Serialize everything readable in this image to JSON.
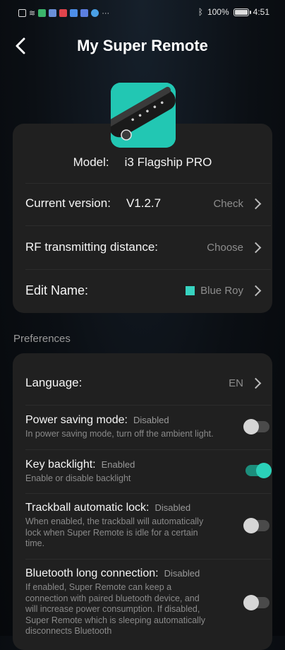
{
  "status_bar": {
    "battery_percent": "100%",
    "time": "4:51"
  },
  "header": {
    "title": "My Super Remote"
  },
  "device": {
    "model_label": "Model:",
    "model_value": "i3 Flagship PRO",
    "version_label": "Current version:",
    "version_value": "V1.2.7",
    "version_action": "Check",
    "rf_label": "RF transmitting distance:",
    "rf_action": "Choose",
    "name_label": "Edit Name:",
    "name_value": "Blue Roy",
    "name_color": "#37d3c0"
  },
  "preferences": {
    "section_title": "Preferences",
    "language_label": "Language:",
    "language_value": "EN",
    "items": [
      {
        "title": "Power saving mode:",
        "state": "Disabled",
        "desc": "In power saving mode, turn off the ambient light.",
        "enabled": false
      },
      {
        "title": "Key backlight:",
        "state": "Enabled",
        "desc": "Enable or disable backlight",
        "enabled": true
      },
      {
        "title": "Trackball automatic lock:",
        "state": "Disabled",
        "desc": "When enabled, the trackball will automatically lock when Super Remote is idle for a certain time.",
        "enabled": false
      },
      {
        "title": "Bluetooth long connection:",
        "state": "Disabled",
        "desc": "If enabled, Super Remote can keep a connection with paired bluetooth device, and will increase power consumption. If disabled, Super Remote which is sleeping automatically disconnects Bluetooth",
        "enabled": false
      }
    ]
  },
  "colors": {
    "accent": "#2bd1b9",
    "card_bg": "#202020"
  }
}
